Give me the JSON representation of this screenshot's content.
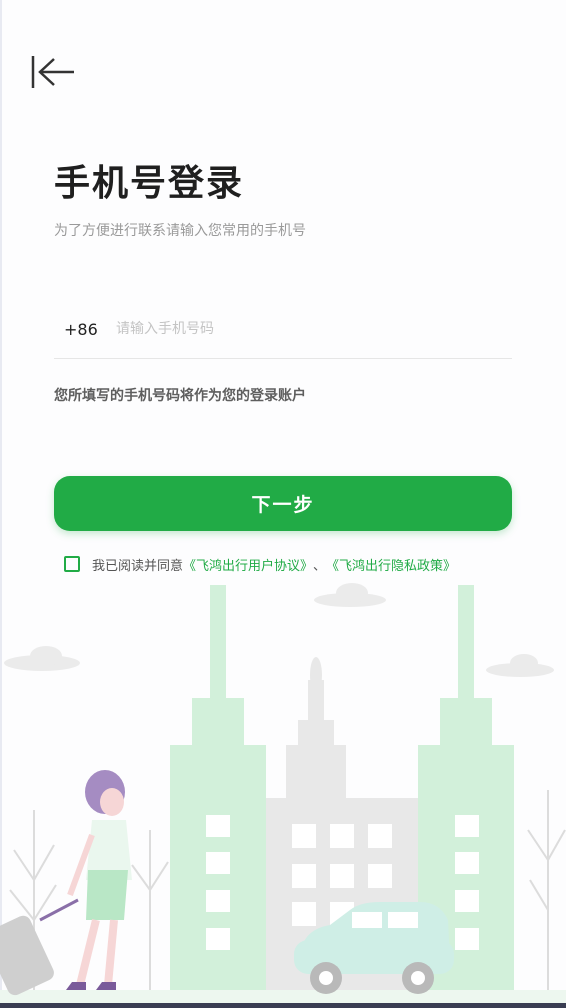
{
  "header": {
    "back_icon": "collapse-left-arrow-icon"
  },
  "login": {
    "title": "手机号登录",
    "subtitle": "为了方便进行联系请输入您常用的手机号",
    "country_code": "+86",
    "phone_value": "",
    "phone_placeholder": "请输入手机号码",
    "hint": "您所填写的手机号码将作为您的登录账户",
    "next_label": "下一步"
  },
  "agreement": {
    "checked": false,
    "prefix": "我已阅读并同意",
    "user_agreement": "《飞鸿出行用户协议》",
    "separator": "、",
    "privacy_policy": "《飞鸿出行隐私政策》"
  },
  "colors": {
    "accent": "#21ab46",
    "background": "#fdfdfe",
    "building_green": "#d2f0da",
    "building_gray": "#e8e8e8"
  }
}
